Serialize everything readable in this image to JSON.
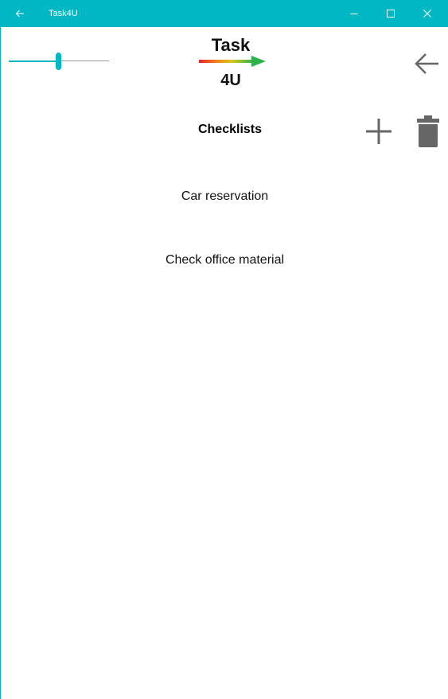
{
  "titlebar": {
    "title": "Task4U",
    "back_icon": "back-arrow-icon",
    "minimize_icon": "minimize-icon",
    "maximize_icon": "maximize-icon",
    "close_icon": "close-icon",
    "color": "#00b7c3"
  },
  "header": {
    "slider_value": 0.5,
    "logo": {
      "top": "Task",
      "bottom": "4U"
    },
    "back_icon": "back-arrow-icon"
  },
  "section": {
    "title": "Checklists",
    "add_icon": "plus-icon",
    "delete_icon": "trash-icon"
  },
  "checklists": [
    "Car reservation",
    "Check office material"
  ]
}
